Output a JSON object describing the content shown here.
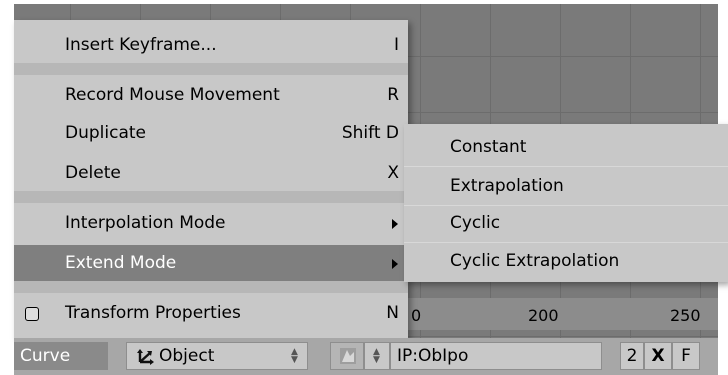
{
  "main_menu": {
    "items": [
      {
        "label": "Insert Keyframe...",
        "key": "I"
      },
      {
        "label": "Record Mouse Movement",
        "key": "R"
      },
      {
        "label": "Duplicate",
        "key": "Shift D"
      },
      {
        "label": "Delete",
        "key": "X"
      },
      {
        "label": "Interpolation Mode",
        "key": ""
      },
      {
        "label": "Extend Mode",
        "key": ""
      },
      {
        "label": "Transform Properties",
        "key": "N"
      }
    ],
    "highlighted": "Extend Mode"
  },
  "submenu": {
    "items": [
      {
        "label": "Constant"
      },
      {
        "label": "Extrapolation"
      },
      {
        "label": "Cyclic"
      },
      {
        "label": "Cyclic Extrapolation"
      }
    ]
  },
  "scale": {
    "labels": [
      "0",
      "200",
      "250"
    ]
  },
  "header": {
    "curve_menu": "Curve",
    "object_select": "Object",
    "ipo_name": "IP:ObIpo",
    "users_count": "2",
    "unlink": "X",
    "fake_user": "F"
  },
  "colors": {
    "menu_bg": "#c8c8c8",
    "highlight_bg": "#7f7f7f",
    "graph_bg": "#7a7a7a",
    "header_bg": "#a7a7a7"
  }
}
